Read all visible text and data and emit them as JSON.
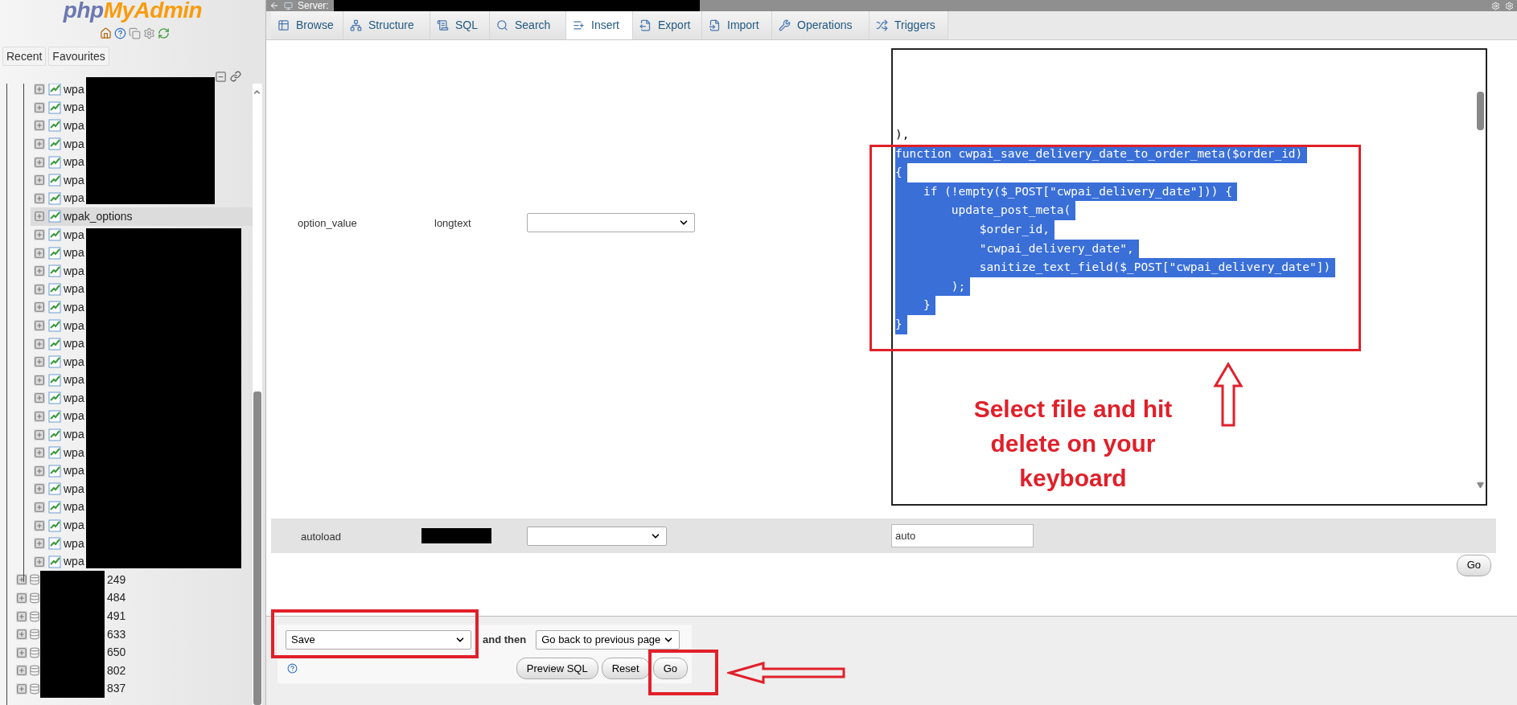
{
  "top_bar": {
    "server_label": "Server:"
  },
  "sidebar": {
    "logo": [
      "php",
      "MyAdmin"
    ],
    "nav_buttons": [
      "Recent",
      "Favourites"
    ],
    "tree": [
      {
        "label": "wpa",
        "kind": "table",
        "selected": false
      },
      {
        "label": "wpa",
        "kind": "table",
        "selected": false
      },
      {
        "label": "wpa",
        "kind": "table",
        "selected": false
      },
      {
        "label": "wpa",
        "kind": "table",
        "selected": false
      },
      {
        "label": "wpa",
        "kind": "table",
        "selected": false
      },
      {
        "label": "wpa",
        "kind": "table",
        "selected": false
      },
      {
        "label": "wpa",
        "kind": "table",
        "selected": false
      },
      {
        "label": "wpak_options",
        "kind": "table",
        "selected": true
      },
      {
        "label": "wpa",
        "kind": "table",
        "selected": false
      },
      {
        "label": "wpa",
        "kind": "table",
        "selected": false
      },
      {
        "label": "wpa",
        "kind": "table",
        "selected": false
      },
      {
        "label": "wpa",
        "kind": "table",
        "selected": false
      },
      {
        "label": "wpa",
        "kind": "table",
        "selected": false
      },
      {
        "label": "wpa",
        "kind": "table",
        "selected": false
      },
      {
        "label": "wpa",
        "kind": "table",
        "selected": false
      },
      {
        "label": "wpa",
        "kind": "table",
        "selected": false
      },
      {
        "label": "wpa",
        "kind": "table",
        "selected": false
      },
      {
        "label": "wpa",
        "kind": "table",
        "selected": false
      },
      {
        "label": "wpa",
        "kind": "table",
        "selected": false
      },
      {
        "label": "wpa",
        "kind": "table",
        "selected": false
      },
      {
        "label": "wpa",
        "kind": "table",
        "selected": false
      },
      {
        "label": "wpa",
        "kind": "table",
        "selected": false
      },
      {
        "label": "wpa",
        "kind": "table",
        "selected": false
      },
      {
        "label": "wpa",
        "kind": "table",
        "selected": false
      },
      {
        "label": "wpa",
        "kind": "table",
        "selected": false
      },
      {
        "label": "wpa",
        "kind": "table",
        "selected": false
      },
      {
        "label": "wpa",
        "kind": "table",
        "selected": false
      },
      {
        "label": "249",
        "kind": "database",
        "selected": false
      },
      {
        "label": "484",
        "kind": "database",
        "selected": false
      },
      {
        "label": "491",
        "kind": "database",
        "selected": false
      },
      {
        "label": "633",
        "kind": "database",
        "selected": false
      },
      {
        "label": "650",
        "kind": "database",
        "selected": false
      },
      {
        "label": "802",
        "kind": "database",
        "selected": false
      },
      {
        "label": "837",
        "kind": "database",
        "selected": false
      }
    ]
  },
  "tabs": [
    {
      "label": "Browse",
      "selected": false
    },
    {
      "label": "Structure",
      "selected": false
    },
    {
      "label": "SQL",
      "selected": false
    },
    {
      "label": "Search",
      "selected": false
    },
    {
      "label": "Insert",
      "selected": true
    },
    {
      "label": "Export",
      "selected": false
    },
    {
      "label": "Import",
      "selected": false
    },
    {
      "label": "Operations",
      "selected": false
    },
    {
      "label": "Triggers",
      "selected": false
    }
  ],
  "rows": [
    {
      "column": "option_value",
      "type": "longtext",
      "kind": "textarea",
      "lines": [
        {
          "text": "),",
          "selected": false
        },
        {
          "text": "function cwpai_save_delivery_date_to_order_meta($order_id)",
          "selected": true
        },
        {
          "text": "{",
          "selected": true
        },
        {
          "text": "    if (!empty($_POST[\"cwpai_delivery_date\"])) {",
          "selected": true
        },
        {
          "text": "        update_post_meta(",
          "selected": true
        },
        {
          "text": "            $order_id,",
          "selected": true
        },
        {
          "text": "            \"cwpai_delivery_date\",",
          "selected": true
        },
        {
          "text": "            sanitize_text_field($_POST[\"cwpai_delivery_date\"])",
          "selected": true
        },
        {
          "text": "        );",
          "selected": true
        },
        {
          "text": "    }",
          "selected": true
        },
        {
          "text": "}",
          "selected": true
        }
      ]
    },
    {
      "column": "autoload",
      "kind": "input",
      "value": "auto"
    }
  ],
  "row_go": "Go",
  "footer": {
    "action": "Save",
    "and_then": "and then",
    "after": "Go back to previous page",
    "buttons": [
      "Preview SQL",
      "Reset",
      "Go"
    ]
  },
  "annotation": {
    "callout": "Select file and hit delete on your keyboard"
  }
}
